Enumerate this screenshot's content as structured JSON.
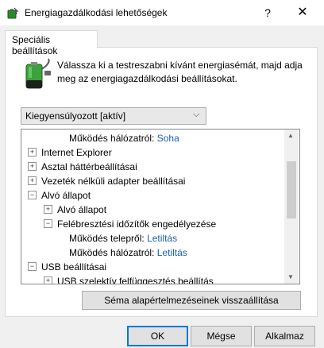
{
  "window": {
    "title": "Energiagazdálkodási lehetőségek",
    "help": "?",
    "close": "✕"
  },
  "tab": {
    "label": "Speciális beállítások"
  },
  "description": "Válassza ki a testreszabni kívánt energiasémát, majd adja meg az energiagazdálkodási beállításokat.",
  "dropdown": {
    "selected": "Kiegyensúlyozott [aktív]"
  },
  "tree": {
    "rows": [
      {
        "label": "Működés hálózatról:",
        "value": "Soha"
      },
      {
        "label": "Internet Explorer",
        "state": "collapsed"
      },
      {
        "label": "Asztal háttérbeállításai",
        "state": "collapsed"
      },
      {
        "label": "Vezeték nélküli adapter beállításai",
        "state": "collapsed"
      },
      {
        "label": "Alvó állapot",
        "state": "expanded"
      },
      {
        "label": "Alvó állapot",
        "state": "collapsed"
      },
      {
        "label": "Felébresztési időzítők engedélyezése",
        "state": "expanded"
      },
      {
        "label": "Működés telepről:",
        "value": "Letiltás"
      },
      {
        "label": "Működés hálózatról:",
        "value": "Letiltás"
      },
      {
        "label": "USB beállításai",
        "state": "expanded"
      },
      {
        "label": "USB szelektív felfüggesztés beállítás"
      }
    ]
  },
  "buttons": {
    "restore": "Séma alapértelmezéseinek visszaállítása",
    "ok": "OK",
    "cancel": "Mégse",
    "apply": "Alkalmaz"
  }
}
